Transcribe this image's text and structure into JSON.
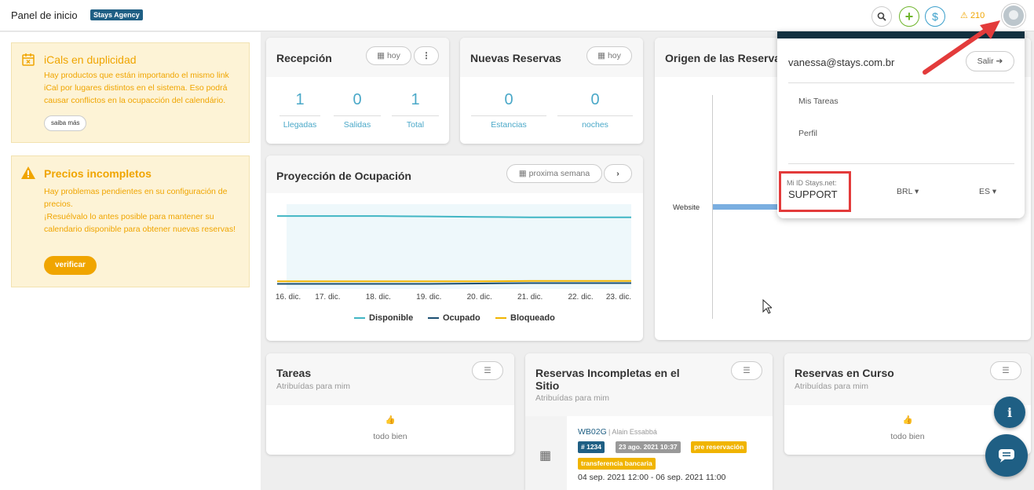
{
  "header": {
    "title": "Panel de inicio",
    "agency": "Stays Agency",
    "alert_count": "210",
    "icons": [
      "search-icon",
      "plus-icon",
      "dollar-icon",
      "warning-icon",
      "avatar"
    ]
  },
  "alerts": [
    {
      "title": "iCals en duplicidad",
      "text": "Hay productos que están importando el mismo link iCal por lugares distintos en el sistema. Eso podrá causar conflictos en la ocupacción del calendário.",
      "button": "saiba más",
      "icon": "calendar-x-icon"
    },
    {
      "title": "Precios incompletos",
      "text": "Hay problemas pendientes en su configuración de precios.\n¡Resuélvalo lo antes posible para mantener su calendario disponible para obtener nuevas reservas!",
      "button": "verificar",
      "icon": "warning-icon"
    }
  ],
  "reception": {
    "title": "Recepción",
    "filter": "hoy",
    "stats": [
      {
        "value": "1",
        "label": "Llegadas"
      },
      {
        "value": "0",
        "label": "Salidas"
      },
      {
        "value": "1",
        "label": "Total"
      }
    ]
  },
  "new_bookings": {
    "title": "Nuevas Reservas",
    "filter": "hoy",
    "stats": [
      {
        "value": "0",
        "label": "Estancias"
      },
      {
        "value": "0",
        "label": "noches"
      }
    ]
  },
  "occupancy": {
    "title": "Proyección de Ocupación",
    "filter": "proxima semana"
  },
  "chart_data": {
    "type": "line",
    "x": [
      "16. dic.",
      "17. dic.",
      "18. dic.",
      "19. dic.",
      "20. dic.",
      "21. dic.",
      "22. dic.",
      "23. dic."
    ],
    "series": [
      {
        "name": "Disponible",
        "color": "#41b6c4",
        "values": [
          0.86,
          0.86,
          0.86,
          0.855,
          0.85,
          0.845,
          0.845,
          0.845
        ]
      },
      {
        "name": "Ocupado",
        "color": "#1b4f72",
        "values": [
          0.06,
          0.06,
          0.06,
          0.06,
          0.065,
          0.07,
          0.07,
          0.07
        ]
      },
      {
        "name": "Bloqueado",
        "color": "#f0b400",
        "values": [
          0.09,
          0.09,
          0.09,
          0.09,
          0.09,
          0.095,
          0.095,
          0.095
        ]
      }
    ],
    "ylim": [
      0,
      1
    ],
    "grid": false,
    "legend": "bottom"
  },
  "origin": {
    "title": "Origen de las Reservas",
    "bar_label": "Website"
  },
  "user_menu": {
    "email": "vanessa@stays.com.br",
    "logout": "Salir",
    "items": [
      "Mis Tareas",
      "Perfil"
    ],
    "id_label": "Mi ID Stays.net:",
    "id_value": "SUPPORT",
    "currency": "BRL",
    "language": "ES"
  },
  "tasks": {
    "title": "Tareas",
    "subtitle": "Atribuídas para mim",
    "empty": "todo bien"
  },
  "incomplete": {
    "title": "Reservas Incompletas en el Sitio",
    "subtitle": "Atribuídas para mim",
    "booking": {
      "code": "WB02G",
      "guest": "| Alain Essabbá",
      "badges": [
        "# 1234",
        "23 ago. 2021 10:37",
        "pre reservación",
        "transferencia bancaria"
      ],
      "dates": "04 sep. 2021 12:00 - 06 sep. 2021 11:00"
    }
  },
  "current": {
    "title": "Reservas en Curso",
    "subtitle": "Atribuídas para mim",
    "empty": "todo bien"
  }
}
